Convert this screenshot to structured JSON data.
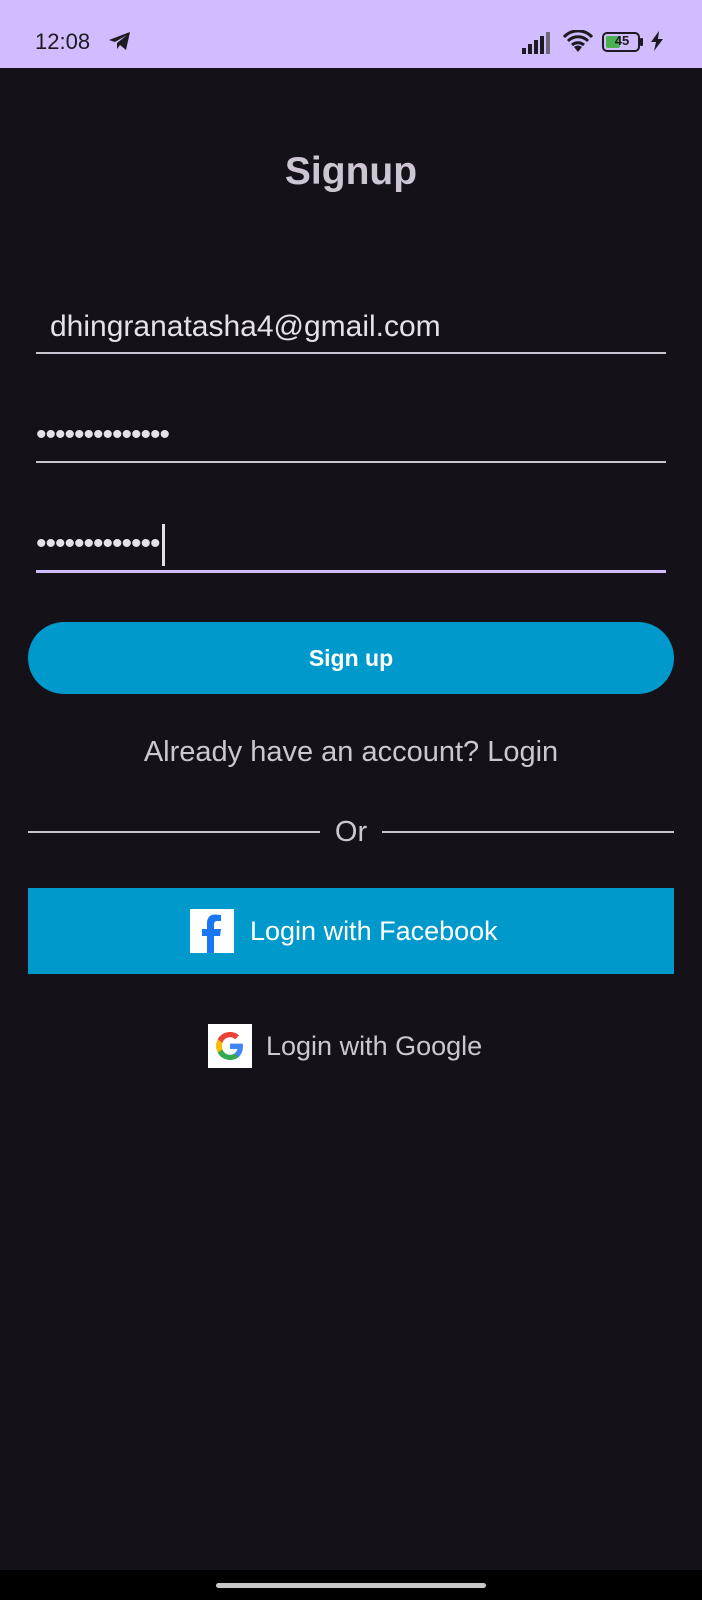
{
  "status_bar": {
    "time": "12:08",
    "battery_level": "45",
    "icons": [
      "telegram-icon",
      "signal-icon",
      "wifi-icon",
      "battery-icon",
      "charging-icon"
    ]
  },
  "screen": {
    "title": "Signup"
  },
  "form": {
    "email_value": "dhingranatasha4@gmail.com",
    "password_value": "••••••••••••••",
    "confirm_password_value": "•••••••••••••"
  },
  "actions": {
    "signup_label": "Sign up",
    "login_link_label": "Already have an account? Login",
    "divider_label": "Or",
    "facebook_label": "Login with Facebook",
    "google_label": "Login with Google"
  },
  "colors": {
    "background": "#141218",
    "status_bar": "#d0bcff",
    "primary_button": "#0099cc",
    "text": "#cdc6d2"
  }
}
